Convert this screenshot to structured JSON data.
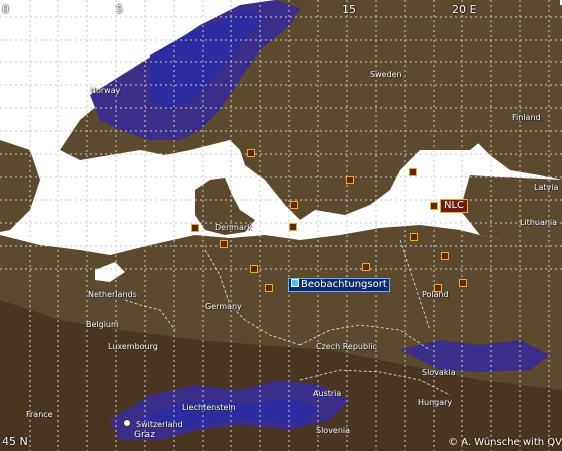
{
  "grid": {
    "lon_ticks": [
      "0",
      "5",
      "15",
      "20 E"
    ],
    "lat_ticks": [
      "45 N"
    ]
  },
  "countries": {
    "sweden": "Sweden",
    "norway": "Norway",
    "finland": "Finland",
    "denmark": "Denmark",
    "netherlands": "Netherlands",
    "belgium": "Belgium",
    "luxembourg": "Luxembourg",
    "germany": "Germany",
    "poland": "Poland",
    "czech": "Czech Republic",
    "slovakia": "Slovakia",
    "austria": "Austria",
    "hungary": "Hungary",
    "switzerland": "Switzerland",
    "liechtenstein": "Liechtenstein",
    "slovenia": "Slovenia",
    "france": "France",
    "latvia": "Latvia",
    "lithuania": "Lithuania"
  },
  "observer_label": "Beobachtungsort",
  "nlc_label": "NLC",
  "city_label": "Graz",
  "credit": "© A. Wünsche with QV",
  "colors": {
    "sea": "#ffffff",
    "lowland": "#5c4a2c",
    "highland": "#3a2a8a",
    "marker_border": "#f6a623",
    "grid": "#c8c8c8"
  }
}
